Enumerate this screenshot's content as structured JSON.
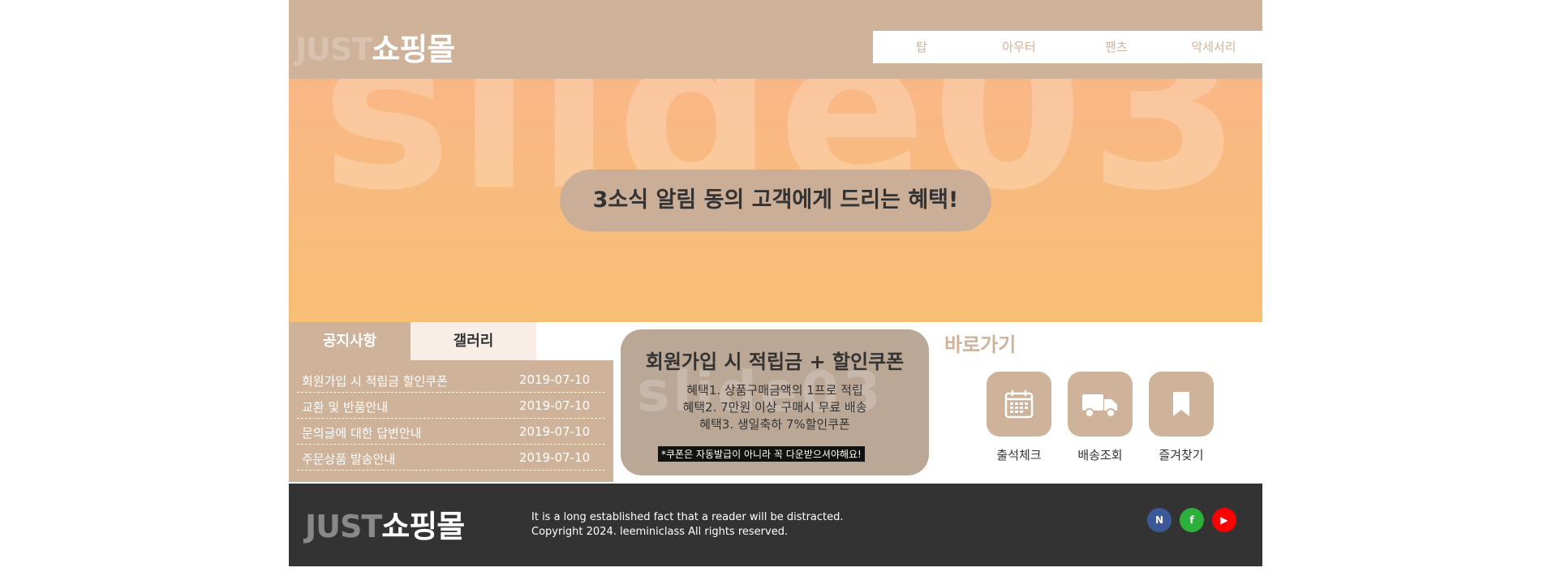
{
  "header": {
    "logo_just": "JUST",
    "logo_mall": "쇼핑몰",
    "nav": [
      "탑",
      "아우터",
      "팬츠",
      "악세서리"
    ]
  },
  "slider": {
    "bg_text": "slide03",
    "caption": "3소식 알림 동의 고객에게 드리는 혜택!"
  },
  "tabs": {
    "notice": "공지사항",
    "gallery": "갤러리"
  },
  "notices": [
    {
      "title": "회원가입 시 적립금 할인쿠폰",
      "date": "2019-07-10"
    },
    {
      "title": "교환 및 반품안내",
      "date": "2019-07-10"
    },
    {
      "title": "문의글에 대한 답변안내",
      "date": "2019-07-10"
    },
    {
      "title": "주문상품 발송안내",
      "date": "2019-07-10"
    }
  ],
  "banner": {
    "title": "회원가입 시 적립금 + 할인쿠폰",
    "benefits": [
      "혜택1. 상품구매금액의 1프로 적립",
      "혜택2. 7만원 이상 구매시 무료 배송",
      "혜택3. 생일축하 7%할인쿠폰"
    ],
    "note": "*쿠폰은 자동발급이 아니라 꼭 다운받으셔야해요!"
  },
  "quick": {
    "title": "바로가기",
    "items": [
      {
        "label": "출석체크",
        "icon": "calendar-icon"
      },
      {
        "label": "배송조회",
        "icon": "truck-icon"
      },
      {
        "label": "즐겨찾기",
        "icon": "bookmark-icon"
      }
    ]
  },
  "footer": {
    "logo_just": "JUST",
    "logo_mall": "쇼핑몰",
    "line1": "It is a long established fact that a reader will be distracted.",
    "line2": "Copyright 2024. leeminiclass All rights reserved.",
    "sns": [
      {
        "label": "N",
        "icon": "naver-icon",
        "color": "#3b5998"
      },
      {
        "label": "f",
        "icon": "facebook-icon",
        "color": "#2db039"
      },
      {
        "label": "▶",
        "icon": "youtube-icon",
        "color": "#ff0000"
      }
    ]
  },
  "colors": {
    "brand": "#cfb29a",
    "footer_bg": "#333333",
    "slider_top": "#f9b786",
    "slider_bottom": "#f8bf75"
  }
}
